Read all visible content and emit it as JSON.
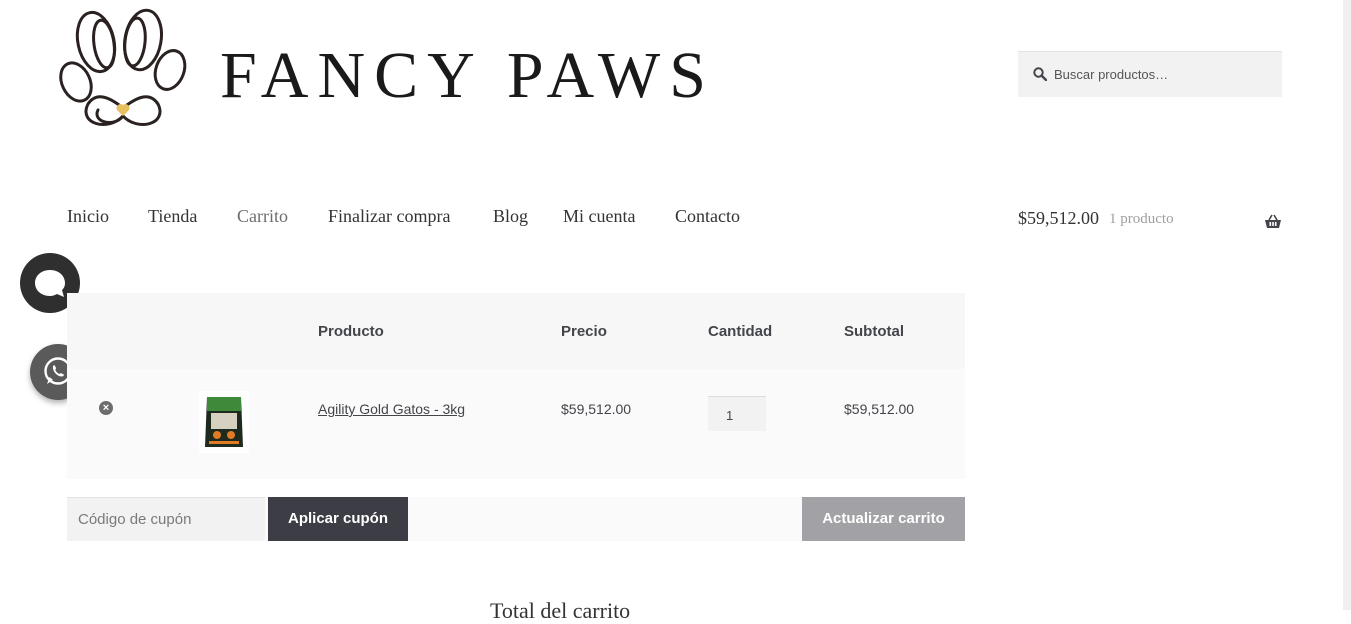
{
  "brand": {
    "name": "FANCY PAWS"
  },
  "search": {
    "placeholder": "Buscar productos…",
    "icon": "search-icon"
  },
  "nav": {
    "items": [
      {
        "label": "Inicio"
      },
      {
        "label": "Tienda"
      },
      {
        "label": "Carrito",
        "current": true
      },
      {
        "label": "Finalizar compra"
      },
      {
        "label": "Blog"
      },
      {
        "label": "Mi cuenta"
      },
      {
        "label": "Contacto"
      }
    ]
  },
  "mini_cart": {
    "amount": "$59,512.00",
    "count": "1 producto",
    "icon": "basket-icon"
  },
  "cart": {
    "headers": {
      "product": "Producto",
      "price": "Precio",
      "quantity": "Cantidad",
      "subtotal": "Subtotal"
    },
    "rows": [
      {
        "product": "Agility Gold Gatos - 3kg",
        "price": "$59,512.00",
        "quantity": "1",
        "subtotal": "$59,512.00"
      }
    ]
  },
  "actions": {
    "coupon_placeholder": "Código de cupón",
    "apply_coupon": "Aplicar cupón",
    "update_cart": "Actualizar carrito"
  },
  "totals": {
    "heading": "Total del carrito"
  },
  "colors": {
    "dark_button": "#3d3d45",
    "disabled_button": "#a1a1a6",
    "panel": "#f7f7f7"
  }
}
